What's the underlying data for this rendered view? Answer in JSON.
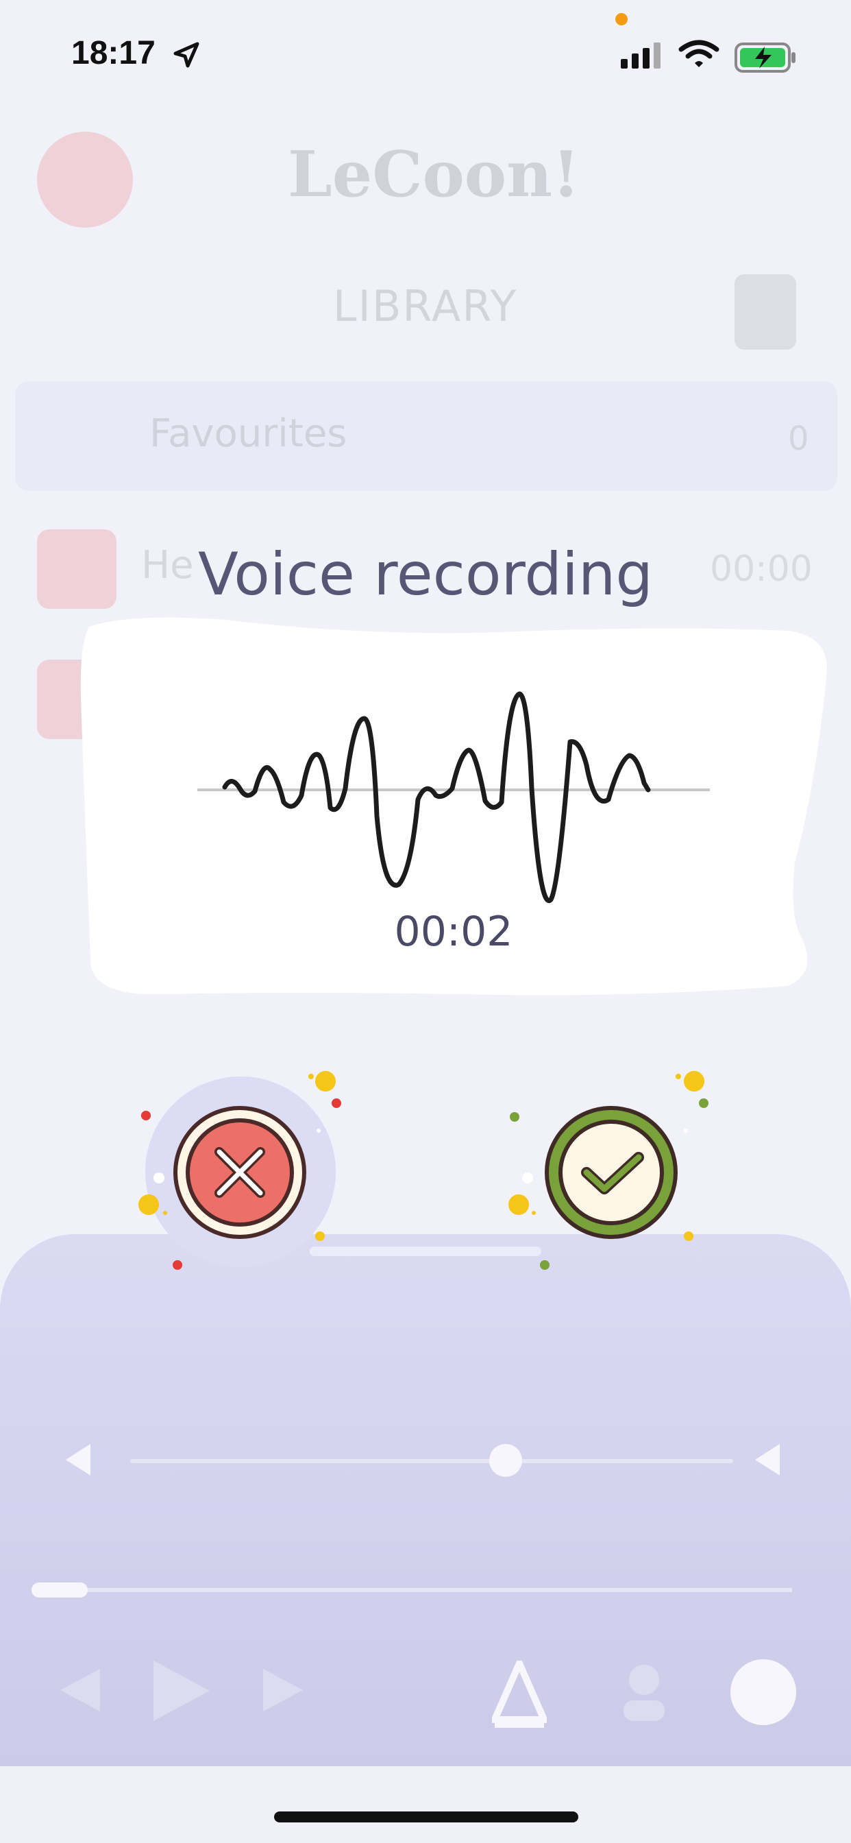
{
  "status_bar": {
    "time": "18:17",
    "icons": [
      "location-arrow-icon",
      "signal-icon",
      "wifi-icon",
      "battery-charging-icon"
    ]
  },
  "background_app": {
    "logo_text": "LeCoon!",
    "section_title": "LIBRARY",
    "rows": [
      {
        "label": "Favourites",
        "value": "0"
      },
      {
        "label": "He",
        "value": "00:00"
      }
    ]
  },
  "dialog": {
    "title": "Voice recording",
    "timer": "00:02",
    "cancel_icon": "close-icon",
    "confirm_icon": "check-icon",
    "colors": {
      "cancel": "#ec6f68",
      "confirm": "#7aa23a",
      "title": "#575775"
    }
  }
}
